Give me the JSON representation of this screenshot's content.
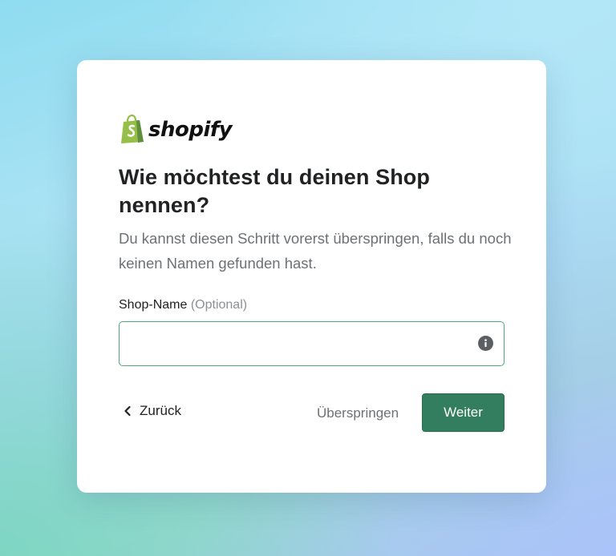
{
  "brand": {
    "logo_text": "shopify",
    "logo_icon": "shopify-bag-icon",
    "logo_color": "#95bf47"
  },
  "dialog": {
    "title": "Wie möchtest du deinen Shop nennen?",
    "subtitle": "Du kannst diesen Schritt vorerst überspringen, falls du noch keinen Namen gefunden hast.",
    "field": {
      "label": "Shop-Name",
      "optional": "(Optional)",
      "value": "",
      "placeholder": "",
      "info_icon": "info-icon"
    },
    "actions": {
      "back_label": "Zurück",
      "back_icon": "chevron-left-icon",
      "skip_label": "Überspringen",
      "next_label": "Weiter"
    }
  },
  "colors": {
    "primary_button": "#337e5e",
    "input_border_focus": "#4fa97a",
    "text_primary": "#202223",
    "text_secondary": "#6d7175"
  }
}
